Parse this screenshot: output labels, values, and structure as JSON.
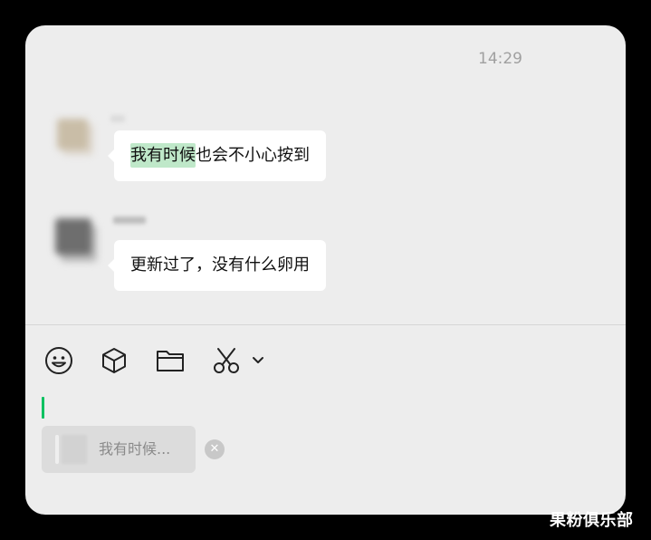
{
  "chat": {
    "timestamp": "14:29",
    "messages": [
      {
        "highlight": "我有时候",
        "rest": "也会不小心按到"
      },
      {
        "text": "更新过了，没有什么卵用"
      }
    ]
  },
  "toolbar": {
    "icons": [
      "emoji-icon",
      "cube-icon",
      "folder-icon",
      "scissors-icon",
      "chevron-down-icon"
    ]
  },
  "input": {
    "quote_text": "我有时候...",
    "close_glyph": "✕"
  },
  "watermark": {
    "text": "果粉俱乐部"
  },
  "colors": {
    "highlight": "#bfe8c9",
    "cursor": "#07c160",
    "window_bg": "#ededed"
  }
}
